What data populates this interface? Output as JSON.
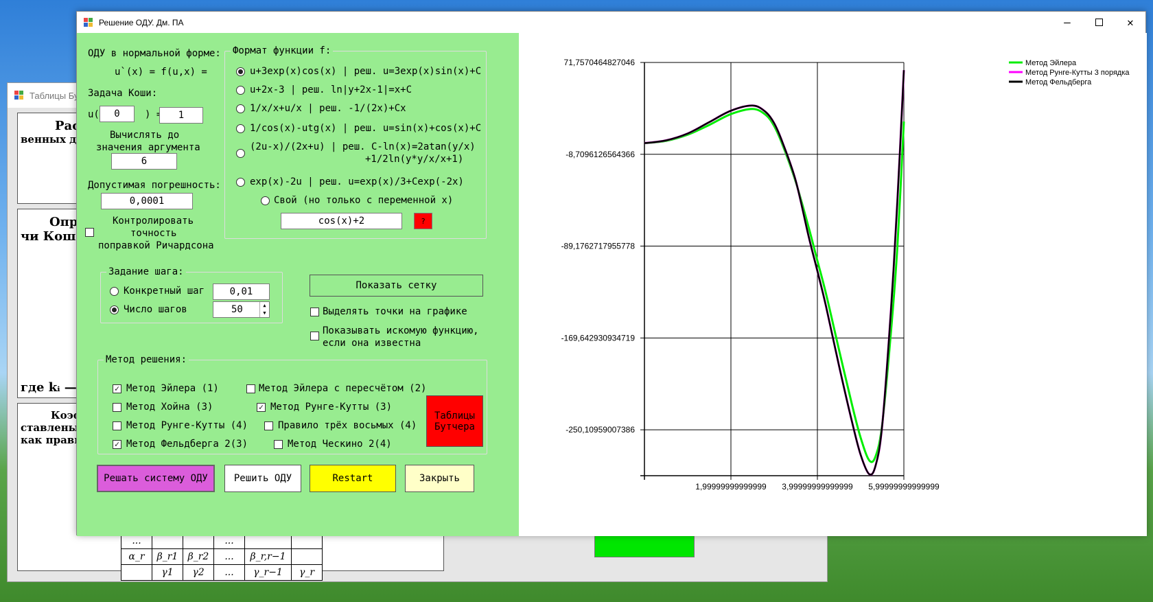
{
  "bg_window": {
    "title": "Таблицы Бут",
    "pane1_lines": [
      "Расс",
      "венных д"
    ],
    "pane2_lines": [
      "Опре",
      "чи Коши д"
    ],
    "pane2_bottom": "где kᵢ — п",
    "pane3_lines": [
      "Коэф",
      "ставлены",
      "как прави"
    ],
    "table_rows": [
      [
        "...",
        "",
        "",
        "...",
        "",
        ""
      ],
      [
        "α_r",
        "β_r1",
        "β_r2",
        "...",
        "β_r,r−1",
        ""
      ],
      [
        "",
        "γ1",
        "γ2",
        "...",
        "γ_r−1",
        "γ_r"
      ]
    ],
    "green_color": "#00e600"
  },
  "window": {
    "title": "Решение ОДУ. Дм. ПА",
    "minimize_icon": "minimize-icon",
    "maximize_icon": "maximize-icon",
    "close_icon": "close-icon"
  },
  "left": {
    "ode_label": "ОДУ в нормальной форме:",
    "ode_formula": "u`(x) = f(u,x) =",
    "cauchy_label": "Задача Коши:",
    "u_open": "u(",
    "u_close": ") =",
    "x0": "0",
    "u0": "1",
    "compute_until_line1": "Вычислять до",
    "compute_until_line2": "значения аргумента",
    "x_end": "6",
    "tolerance_label": "Допустимая погрешность:",
    "tolerance": "0,0001",
    "richardson_line1": "Контролировать",
    "richardson_line2": "точность",
    "richardson_line3": "поправкой Ричардсона",
    "format_label": "Формат функции f:",
    "functions": [
      {
        "text": "u+3exp(x)cos(x) | реш. u=3exp(x)sin(x)+C",
        "selected": true
      },
      {
        "text": "u+2x-3 | реш. ln|y+2x-1|=x+C",
        "selected": false
      },
      {
        "text": "1/x/x+u/x | реш. -1/(2x)+Cx",
        "selected": false
      },
      {
        "text": "1/cos(x)-utg(x) | реш. u=sin(x)+cos(x)+C",
        "selected": false
      },
      {
        "text": "(2u-x)/(2x+u) | реш. C-ln(x)=2atan(y/x)",
        "text2": "+1/2ln(y*y/x/x+1)",
        "selected": false
      },
      {
        "text": "exp(x)-2u | реш. u=exp(x)/3+Cexp(-2x)",
        "selected": false
      }
    ],
    "custom_label": "Свой (но только с переменной x)",
    "custom_value": "cos(x)+2",
    "help_label": "?",
    "step_group": "Задание шага:",
    "step_concrete_label": "Конкретный шаг",
    "step_concrete_value": "0,01",
    "step_count_label": "Число шагов",
    "step_count_value": "50",
    "show_grid": "Показать сетку",
    "highlight_points": "Выделять точки на графике",
    "show_exact_line1": "Показывать искомую функцию,",
    "show_exact_line2": "если она известна",
    "method_group": "Метод решения:",
    "methods": [
      {
        "label": "Метод Эйлера (1)",
        "checked": true
      },
      {
        "label": "Метод Эйлера с пересчётом (2)",
        "checked": false
      },
      {
        "label": "Метод Хойна (3)",
        "checked": false
      },
      {
        "label": "Метод Рунге-Кутты (3)",
        "checked": true
      },
      {
        "label": "Метод Рунге-Кутты (4)",
        "checked": false
      },
      {
        "label": "Правило трёх восьмых (4)",
        "checked": false
      },
      {
        "label": "Метод Фельдберга 2(3)",
        "checked": true
      },
      {
        "label": "Метод Ческино 2(4)",
        "checked": false
      }
    ],
    "butcher_line1": "Таблицы",
    "butcher_line2": "Бутчера",
    "btn_system": "Решать систему ОДУ",
    "btn_solve": "Решить ОДУ",
    "btn_restart": "Restart",
    "btn_close": "Закрыть",
    "colors": {
      "panel": "#98ec90",
      "system": "#db5ddb",
      "restart": "#ffff00",
      "close": "#ffffc8",
      "butcher": "#ff0000",
      "help": "#ff0000"
    }
  },
  "chart_data": {
    "type": "line",
    "title": "",
    "xlabel": "",
    "ylabel": "",
    "xlim": [
      0,
      6
    ],
    "ylim": [
      -290.34,
      71.7570464827046
    ],
    "x_ticks": [
      {
        "value": 2,
        "label": "1,99999999999999"
      },
      {
        "value": 4,
        "label": "3,99999999999999"
      },
      {
        "value": 6,
        "label": "5,99999999999999"
      }
    ],
    "y_ticks": [
      {
        "value": 71.7570464827046,
        "label": "71,7570464827046"
      },
      {
        "value": -8.7096126564366,
        "label": "-8,7096126564366"
      },
      {
        "value": -89.1762717955778,
        "label": "-89,1762717955778"
      },
      {
        "value": -169.642930934719,
        "label": "-169,642930934719"
      },
      {
        "value": -250.10959007386,
        "label": "-250,10959007386"
      }
    ],
    "grid": true,
    "legend_position": "top-right",
    "x": [
      0,
      0.5,
      1,
      1.5,
      2,
      2.5,
      2.8,
      3,
      3.2,
      3.5,
      3.8,
      4,
      4.2,
      4.5,
      4.8,
      5,
      5.2,
      5.35,
      5.5,
      5.7,
      5.85,
      6
    ],
    "series": [
      {
        "name": "Метод Эйлера",
        "color": "#00ee00",
        "values": [
          1,
          3,
          8.5,
          17,
          26.5,
          31,
          26,
          16,
          -1,
          -33,
          -73,
          -102,
          -131,
          -180,
          -228,
          -257,
          -277,
          -273,
          -245,
          -165,
          -90,
          20
        ]
      },
      {
        "name": "Метод Рунге-Кутты 3 порядка",
        "color": "#ff00ff",
        "values": [
          1,
          3.5,
          9.5,
          19.5,
          29.5,
          34,
          28.5,
          18.5,
          1,
          -32,
          -81,
          -111,
          -142,
          -194,
          -243,
          -272,
          -289,
          -281,
          -246,
          -146,
          -50,
          65
        ]
      },
      {
        "name": "Метод Фельдберга",
        "color": "#000000",
        "values": [
          1,
          3.5,
          9.5,
          19.5,
          29.5,
          34,
          28.5,
          18.5,
          1,
          -32,
          -81,
          -111,
          -142,
          -194,
          -243,
          -272,
          -289,
          -281,
          -246,
          -146,
          -50,
          65
        ]
      }
    ]
  }
}
